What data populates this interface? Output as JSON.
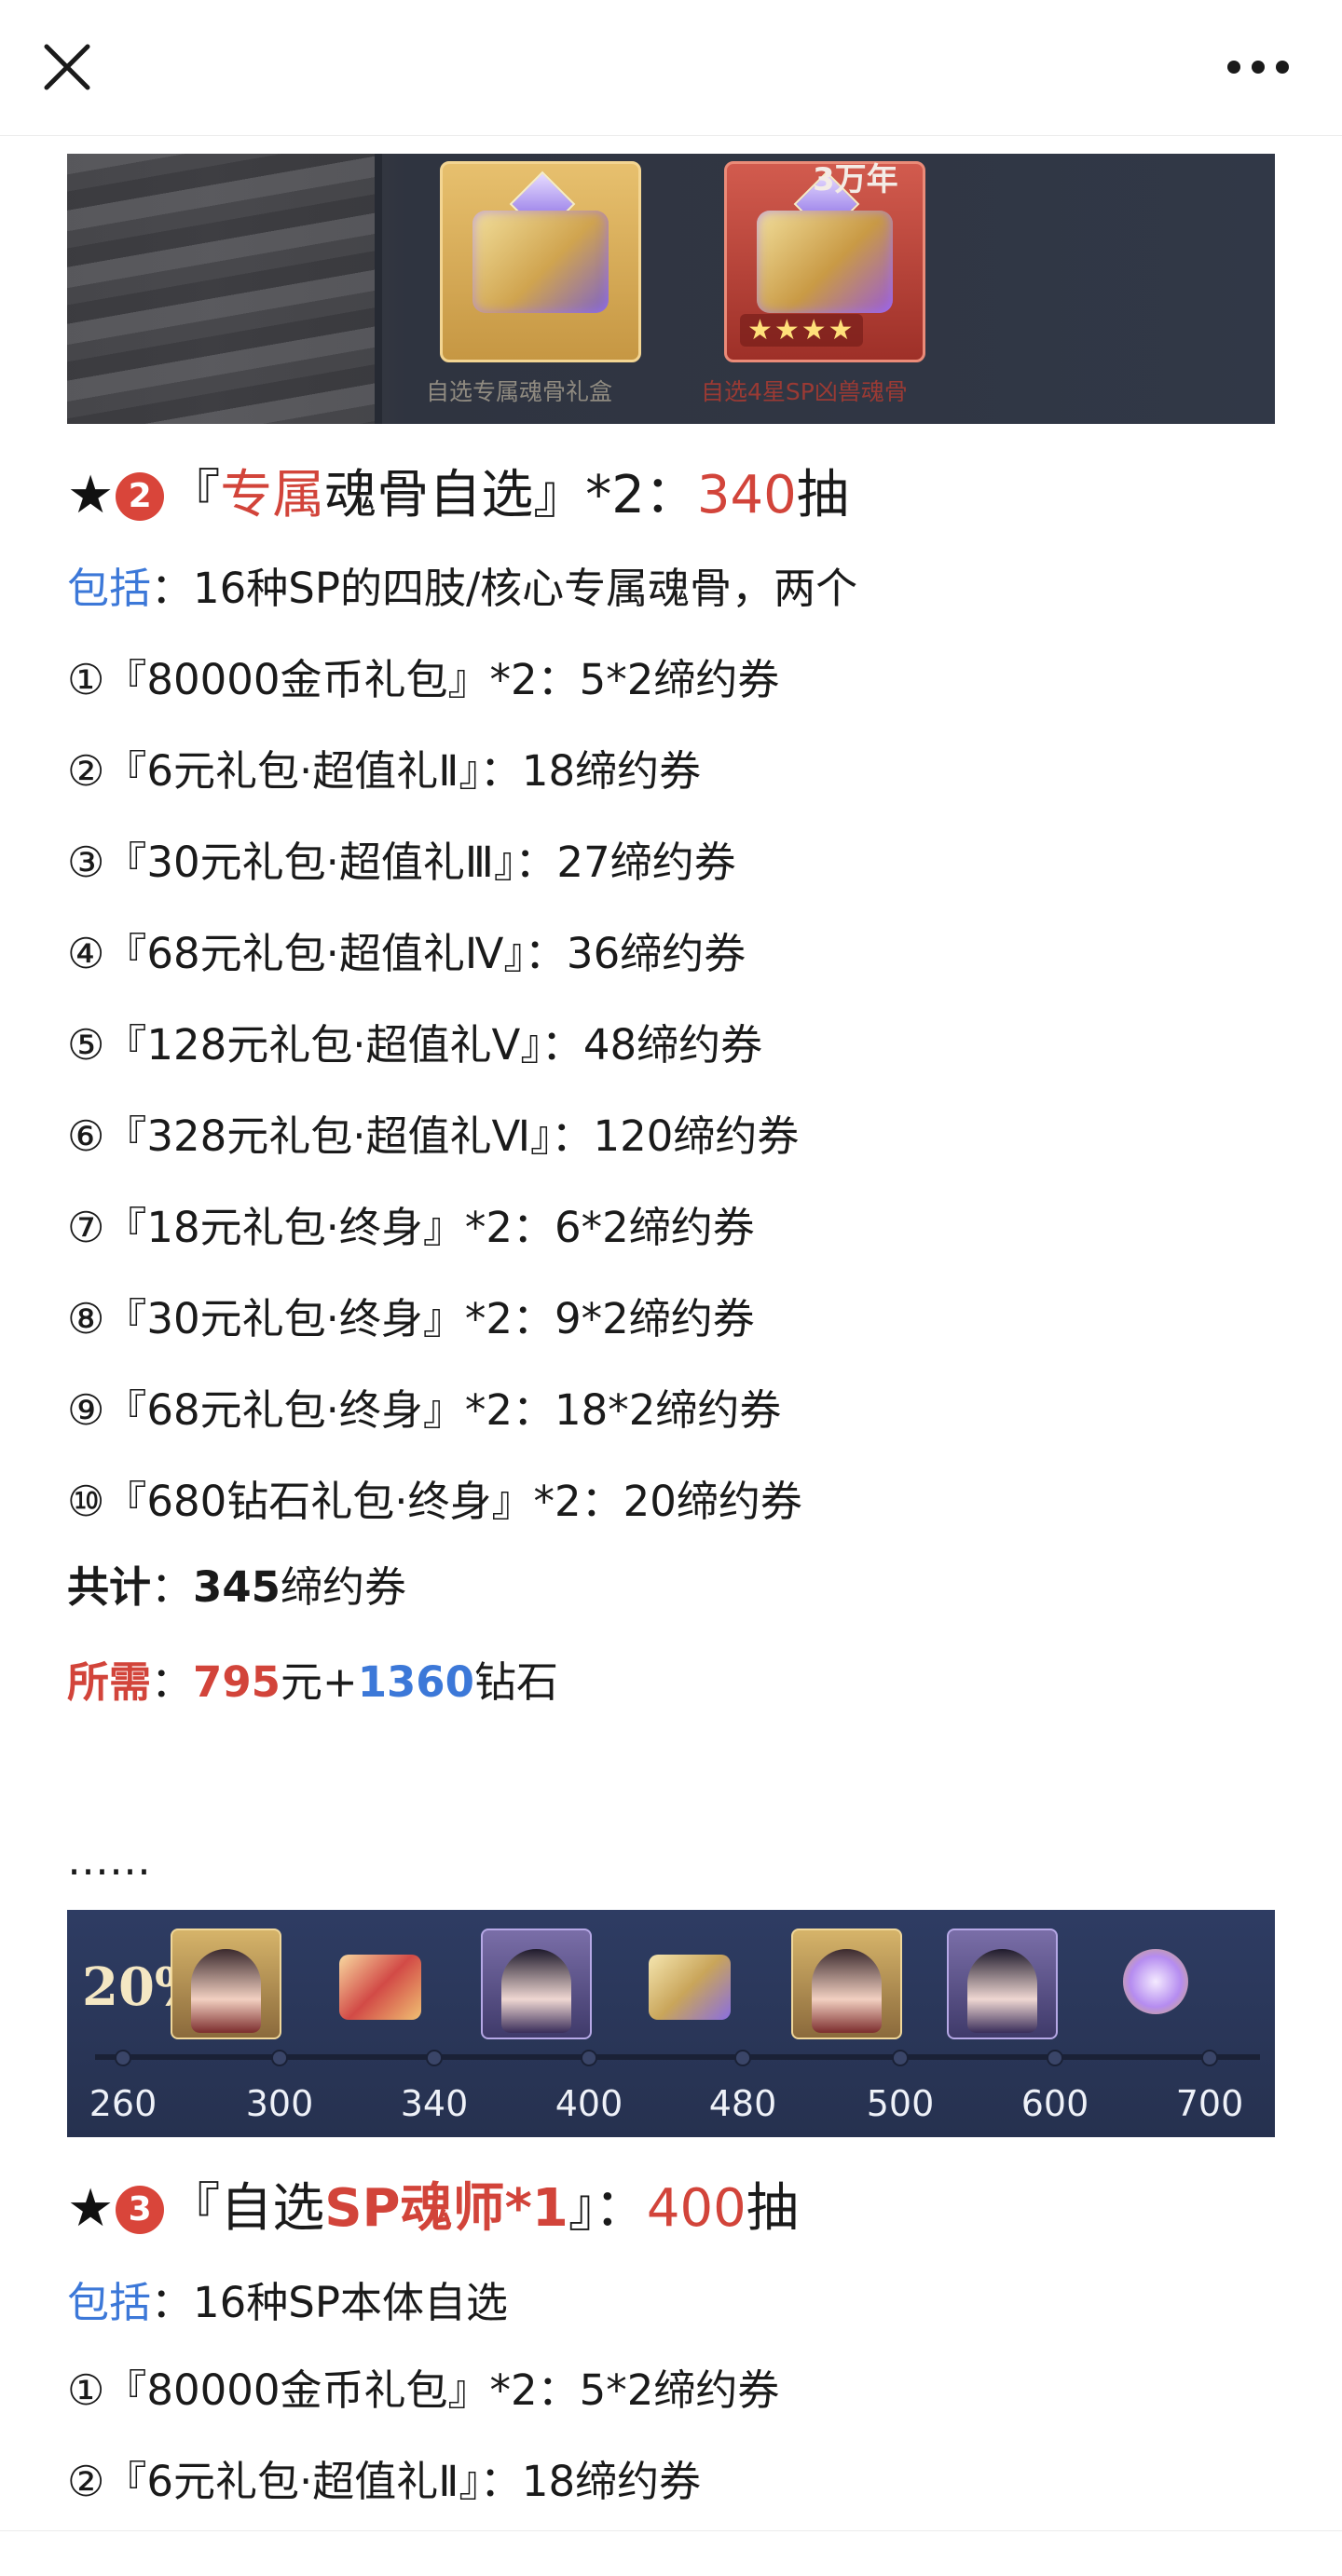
{
  "topbar": {
    "close_icon": "close-icon",
    "more_icon": "more-dots-icon"
  },
  "banner1": {
    "box1_caption": "自选专属魂骨礼盒",
    "box2_caption": "自选4星SP凶兽魂骨",
    "box2_tag": "3万年",
    "box2_stars": "★★★★"
  },
  "section2": {
    "star": "★",
    "badge": "2",
    "title_open": "『",
    "title_red": "专属",
    "title_black": "魂骨自选』*2：",
    "title_count": "340",
    "title_unit": "抽",
    "include_label": "包括",
    "include_text": "：16种SP的四肢/核心专属魂骨，两个",
    "items": [
      "①『80000金币礼包』*2：5*2缔约券",
      "②『6元礼包·超值礼Ⅱ』：18缔约券",
      "③『30元礼包·超值礼Ⅲ』：27缔约券",
      "④『68元礼包·超值礼Ⅳ』：36缔约券",
      "⑤『128元礼包·超值礼Ⅴ』：48缔约券",
      "⑥『328元礼包·超值礼Ⅵ』：120缔约券",
      "⑦『18元礼包·终身』*2：6*2缔约券",
      "⑧『30元礼包·终身』*2：9*2缔约券",
      "⑨『68元礼包·终身』*2：18*2缔约券",
      "⑩『680钻石礼包·终身』*2：20缔约券"
    ],
    "total_label": "共计",
    "total_sep": "：",
    "total_value": "345",
    "total_unit": "缔约券",
    "need_label": "所需",
    "need_sep": "：",
    "need_yuan": "795",
    "need_yuan_unit": "元+",
    "need_diamond": "1360",
    "need_diamond_unit": "钻石",
    "ellipsis": "……"
  },
  "banner2": {
    "percent": "20%",
    "ticks": [
      "260",
      "300",
      "340",
      "400",
      "480",
      "500",
      "600",
      "700"
    ],
    "rewards": [
      "hero-portrait-icon",
      "red-chest-icon",
      "hero-portrait-icon",
      "purple-chest-icon",
      "hero-portrait-icon",
      "hero-portrait-icon",
      "hourglass-orb-icon"
    ]
  },
  "section3": {
    "star": "★",
    "badge": "3",
    "title_open": "『自选",
    "title_red": "SP魂师*1",
    "title_close": "』：",
    "title_count": "400",
    "title_unit": "抽",
    "include_label": "包括",
    "include_text": "：16种SP本体自选",
    "items": [
      "①『80000金币礼包』*2：5*2缔约券",
      "②『6元礼包·超值礼Ⅱ』：18缔约券"
    ]
  }
}
